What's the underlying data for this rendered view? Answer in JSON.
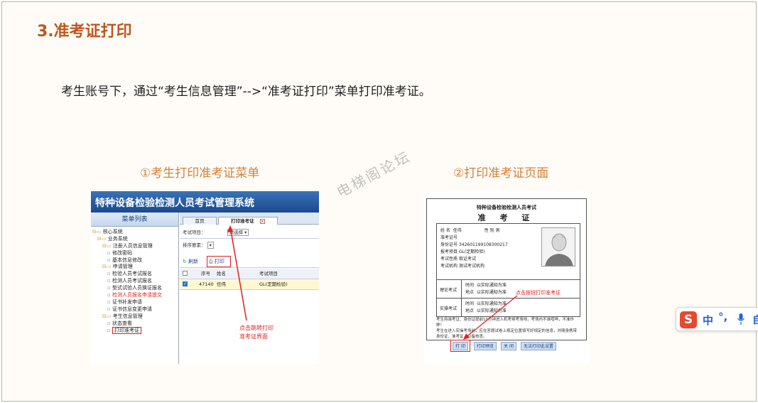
{
  "section_title": "3.准考证打印",
  "intro_text": "考生账号下，通过“考生信息管理”-->“准考证打印”菜单打印准考证。",
  "caption_left": "①考生打印准考证菜单",
  "caption_right": "②打印准考证页面",
  "watermark": "电梯阁论坛",
  "shot1": {
    "system_title": "特种设备检验检测人员考试管理系统",
    "menu_title": "菜单列表",
    "tree": [
      {
        "label": "核心系统",
        "level": 0,
        "type": "folder"
      },
      {
        "label": "业务系统",
        "level": 1,
        "type": "folder"
      },
      {
        "label": "注册人员信息管理",
        "level": 2,
        "type": "folder"
      },
      {
        "label": "修改密码",
        "level": 3,
        "type": "file"
      },
      {
        "label": "基本信息修改",
        "level": 3,
        "type": "file"
      },
      {
        "label": "申请管理",
        "level": 2,
        "type": "folder"
      },
      {
        "label": "检验人员考试报名",
        "level": 3,
        "type": "file"
      },
      {
        "label": "检测人员考试报名",
        "level": 3,
        "type": "file"
      },
      {
        "label": "型式试验人员换证报名",
        "level": 3,
        "type": "file"
      },
      {
        "label": "检测人员报名申请提交",
        "level": 3,
        "type": "file",
        "red": true
      },
      {
        "label": "证书补发申请",
        "level": 3,
        "type": "file"
      },
      {
        "label": "证书信息变更申请",
        "level": 3,
        "type": "file"
      },
      {
        "label": "考生信息管理",
        "level": 2,
        "type": "folder"
      },
      {
        "label": "状态查看",
        "level": 3,
        "type": "file"
      },
      {
        "label": "打印准考证",
        "level": 3,
        "type": "file",
        "boxed": true
      }
    ],
    "tab_home": "首页",
    "tab_print": "打印准考证",
    "exam_item_label": "考试项目：",
    "exam_item_value": "请选择",
    "sort_label": "排序要素：",
    "btn_refresh": "刷新",
    "btn_print": "打印",
    "col_no": "序号",
    "col_name": "姓名",
    "col_item": "考试项目",
    "row_no": "47140",
    "row_name": "任伟",
    "row_item": "GL(定期检验)",
    "note": "点击跳转打印\n准考证界面"
  },
  "shot2": {
    "org": "特种设备检验检测人员考试",
    "ticket_title": "准 考 证",
    "name_label": "姓  名",
    "name_value": "任伟",
    "gender_label": "性   别",
    "gender_value": "男",
    "ticket_no_label": "准考证号",
    "id_label": "身份证号",
    "id_value": "342601199108300217",
    "item_label": "报考项目",
    "item_value": "GL(定期检验)",
    "cat_label": "考试性质",
    "cat_value": "取证考试",
    "org_label": "考试机构",
    "org_value": "测试考试机构",
    "theory_label": "理论考试",
    "practice_label": "实操考试",
    "time_label": "时间",
    "place_label": "地点",
    "notice": "以实际通知为准",
    "rule1": "考生持准考证、身份证提前10分钟进入机考候考场地，考场内不准喧哗，不准作弊！",
    "rule2": "考生在进入实操考场前，应在答题试卷上规定位置填写好规定的信息，并随身携带身份证、准考证，以备核查。",
    "note": "点击按钮打印准考证",
    "btn_print": "打 印",
    "btn_preview": "打印预览",
    "btn_close": "关 闭",
    "btn_setup": "无法打印此设置"
  },
  "ime": {
    "logo": "S",
    "mode": "中",
    "punct": "°,",
    "more": "自"
  }
}
